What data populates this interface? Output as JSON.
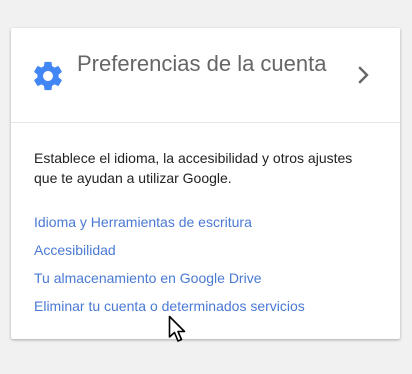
{
  "card": {
    "title": "Preferencias de la cuenta",
    "description": "Establece el idioma, la accesibilidad y otros ajustes que te ayudan a utilizar Google.",
    "header_icon": "gear-icon",
    "arrow_icon": "chevron-right-icon",
    "links": [
      {
        "label": "Idioma y Herramientas de escritura"
      },
      {
        "label": "Accesibilidad"
      },
      {
        "label": "Tu almacenamiento en Google Drive"
      },
      {
        "label": "Eliminar tu cuenta o determinados servicios"
      }
    ]
  },
  "colors": {
    "accent": "#4285f4",
    "link": "#4a79d4",
    "title": "#666666",
    "text": "#222222",
    "background": "#f1f1f1"
  }
}
